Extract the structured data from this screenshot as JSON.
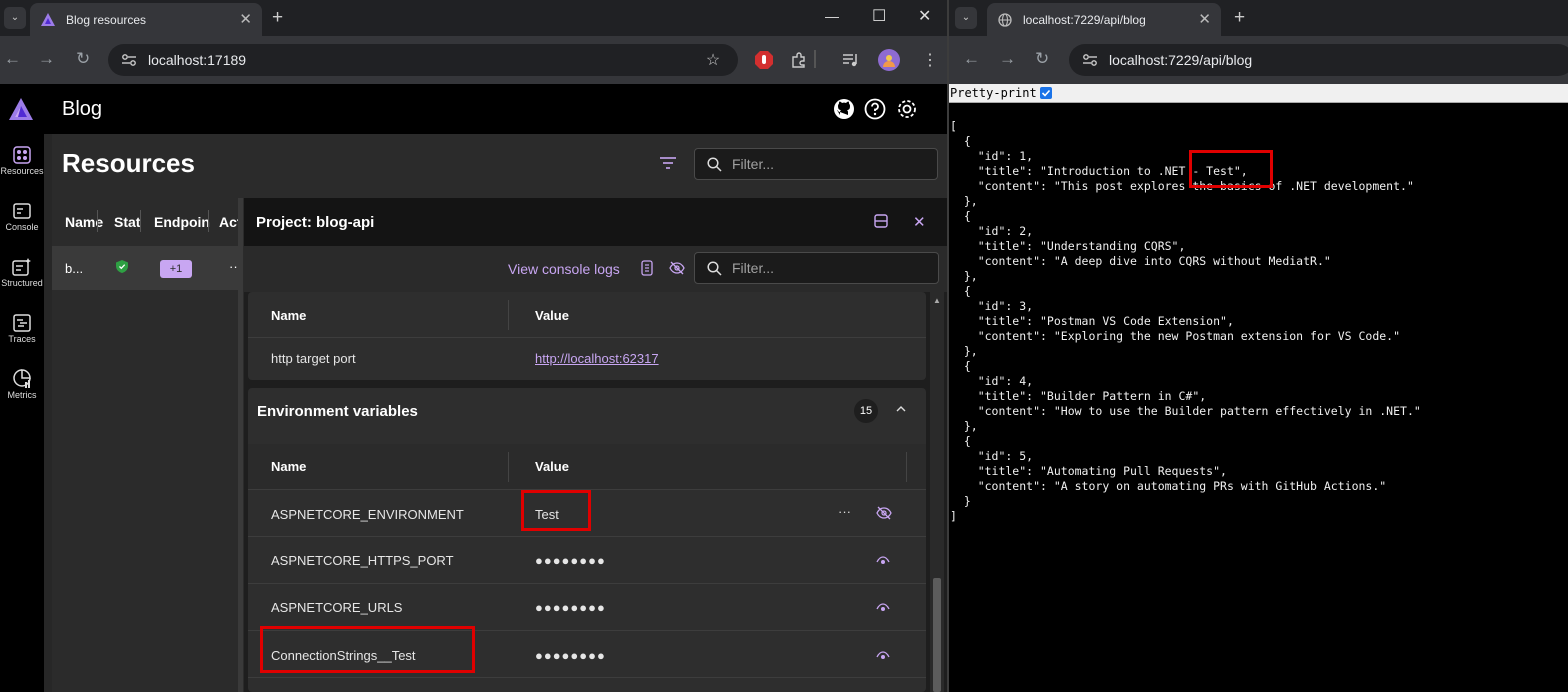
{
  "left_window": {
    "tab_title": "Blog resources",
    "url": "localhost:17189",
    "app": {
      "name": "Blog",
      "rail": [
        {
          "label": "Resources",
          "icon": "resources-icon"
        },
        {
          "label": "Console",
          "icon": "console-icon"
        },
        {
          "label": "Structured",
          "icon": "structured-icon"
        },
        {
          "label": "Traces",
          "icon": "traces-icon"
        },
        {
          "label": "Metrics",
          "icon": "metrics-icon"
        }
      ],
      "page_title": "Resources",
      "filter_placeholder": "Filter...",
      "grid_columns": [
        "Name",
        "Stat",
        "Endpoin",
        "Act"
      ],
      "grid_row": {
        "name": "b...",
        "endpoint_badge": "+1",
        "actions": "···"
      },
      "details": {
        "title": "Project: blog-api",
        "view_logs": "View console logs",
        "filter_placeholder": "Filter...",
        "endpoints": {
          "columns": [
            "Name",
            "Value"
          ],
          "rows": [
            {
              "name": "http target port",
              "value": "http://localhost:62317"
            }
          ]
        },
        "env": {
          "title": "Environment variables",
          "count": "15",
          "columns": [
            "Name",
            "Value"
          ],
          "rows": [
            {
              "name": "ASPNETCORE_ENVIRONMENT",
              "value": "Test"
            },
            {
              "name": "ASPNETCORE_HTTPS_PORT",
              "value": "●●●●●●●●"
            },
            {
              "name": "ASPNETCORE_URLS",
              "value": "●●●●●●●●"
            },
            {
              "name": "ConnectionStrings__Test",
              "value": "●●●●●●●●"
            }
          ],
          "row_menu": "···"
        }
      }
    }
  },
  "right_window": {
    "tab_title": "localhost:7229/api/blog",
    "url": "localhost:7229/api/blog",
    "pretty_print_label": "Pretty-print",
    "json_text": "[\n  {\n    \"id\": 1,\n    \"title\": \"Introduction to .NET - Test\",\n    \"content\": \"This post explores the basics of .NET development.\"\n  },\n  {\n    \"id\": 2,\n    \"title\": \"Understanding CQRS\",\n    \"content\": \"A deep dive into CQRS without MediatR.\"\n  },\n  {\n    \"id\": 3,\n    \"title\": \"Postman VS Code Extension\",\n    \"content\": \"Exploring the new Postman extension for VS Code.\"\n  },\n  {\n    \"id\": 4,\n    \"title\": \"Builder Pattern in C#\",\n    \"content\": \"How to use the Builder pattern effectively in .NET.\"\n  },\n  {\n    \"id\": 5,\n    \"title\": \"Automating Pull Requests\",\n    \"content\": \"A story on automating PRs with GitHub Actions.\"\n  }\n]"
  },
  "colors": {
    "accent": "#c8a6f2",
    "highlight": "#e00000",
    "status_ok": "#2ea043"
  }
}
